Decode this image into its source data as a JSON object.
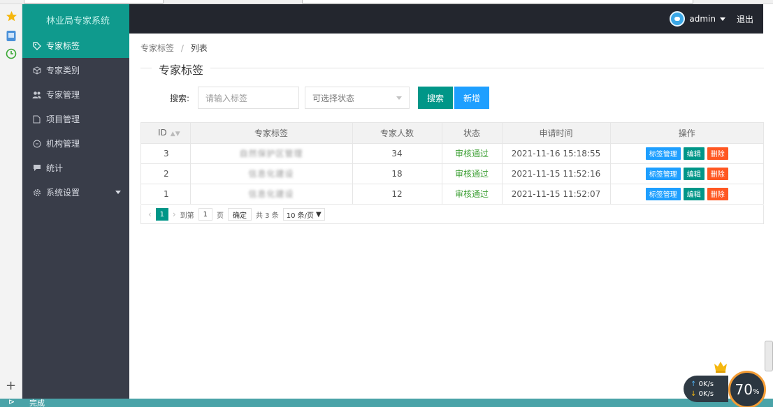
{
  "header": {
    "title": "林业局专家系统",
    "username": "admin",
    "logout": "退出"
  },
  "sidebar": {
    "items": [
      {
        "label": "专家标签",
        "icon": "tag-icon"
      },
      {
        "label": "专家类别",
        "icon": "cube-icon"
      },
      {
        "label": "专家管理",
        "icon": "users-icon"
      },
      {
        "label": "项目管理",
        "icon": "file-icon"
      },
      {
        "label": "机构管理",
        "icon": "circle-icon"
      },
      {
        "label": "统计",
        "icon": "chat-icon"
      },
      {
        "label": "系统设置",
        "icon": "settings-icon"
      }
    ]
  },
  "breadcrumb": {
    "parent": "专家标签",
    "separator": "/",
    "current": "列表"
  },
  "section_title": "专家标签",
  "search": {
    "label": "搜索:",
    "placeholder": "请输入标签",
    "status_placeholder": "可选择状态",
    "search_button": "搜索",
    "add_button": "新增"
  },
  "table": {
    "columns": [
      "ID",
      "专家标签",
      "专家人数",
      "状态",
      "申请时间",
      "操作"
    ],
    "rows": [
      {
        "id": "3",
        "tag": "自然保护区管理",
        "count": "34",
        "status": "审核通过",
        "time": "2021-11-16 15:18:55"
      },
      {
        "id": "2",
        "tag": "信息化建设",
        "count": "18",
        "status": "审核通过",
        "time": "2021-11-15 11:52:16"
      },
      {
        "id": "1",
        "tag": "信息化建设",
        "count": "12",
        "status": "审核通过",
        "time": "2021-11-15 11:52:07"
      }
    ],
    "actions": {
      "tag_manage": "标签管理",
      "edit": "编辑",
      "delete": "删除"
    }
  },
  "pager": {
    "current": "1",
    "goto_label": "到第",
    "goto_value": "1",
    "page_unit": "页",
    "confirm": "确定",
    "total": "共 3 条",
    "page_size": "10 条/页"
  },
  "statusbar": {
    "text": "完成"
  },
  "speed": {
    "up": "0K/s",
    "down": "0K/s",
    "percent": "70",
    "percent_unit": "%"
  },
  "colors": {
    "accent": "#009688",
    "blue": "#1e9fff",
    "red": "#ff5722",
    "sidebar": "#393d49",
    "header": "#23262e"
  }
}
